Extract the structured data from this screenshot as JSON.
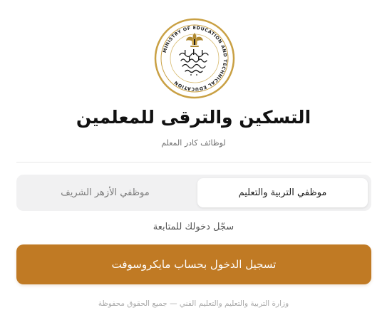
{
  "logo": {
    "ring_text": "MINISTRY OF EDUCATION AND TECHNICAL EDUCATION",
    "arabic_text": "وزارة التربية والتعليم والتعليم الفني",
    "ring_color": "#c9a043",
    "emblem_color": "#b08a33",
    "text_color": "#1f1f1f"
  },
  "header": {
    "title": "التسكين والترقى للمعلمين",
    "subtitle": "لوظائف كادر المعلم"
  },
  "tabs": [
    {
      "label": "موظفي التربية والتعليم",
      "active": true
    },
    {
      "label": "موظفي الأزهر الشريف",
      "active": false
    }
  ],
  "login": {
    "hint": "سجّل دخولك للمتابعة",
    "button_label": "تسجيل الدخول بحساب مايكروسوفت",
    "button_color": "#c07a24"
  },
  "footer": {
    "text": "وزارة التربية والتعليم والتعليم الفني — جميع الحقوق محفوظة"
  }
}
